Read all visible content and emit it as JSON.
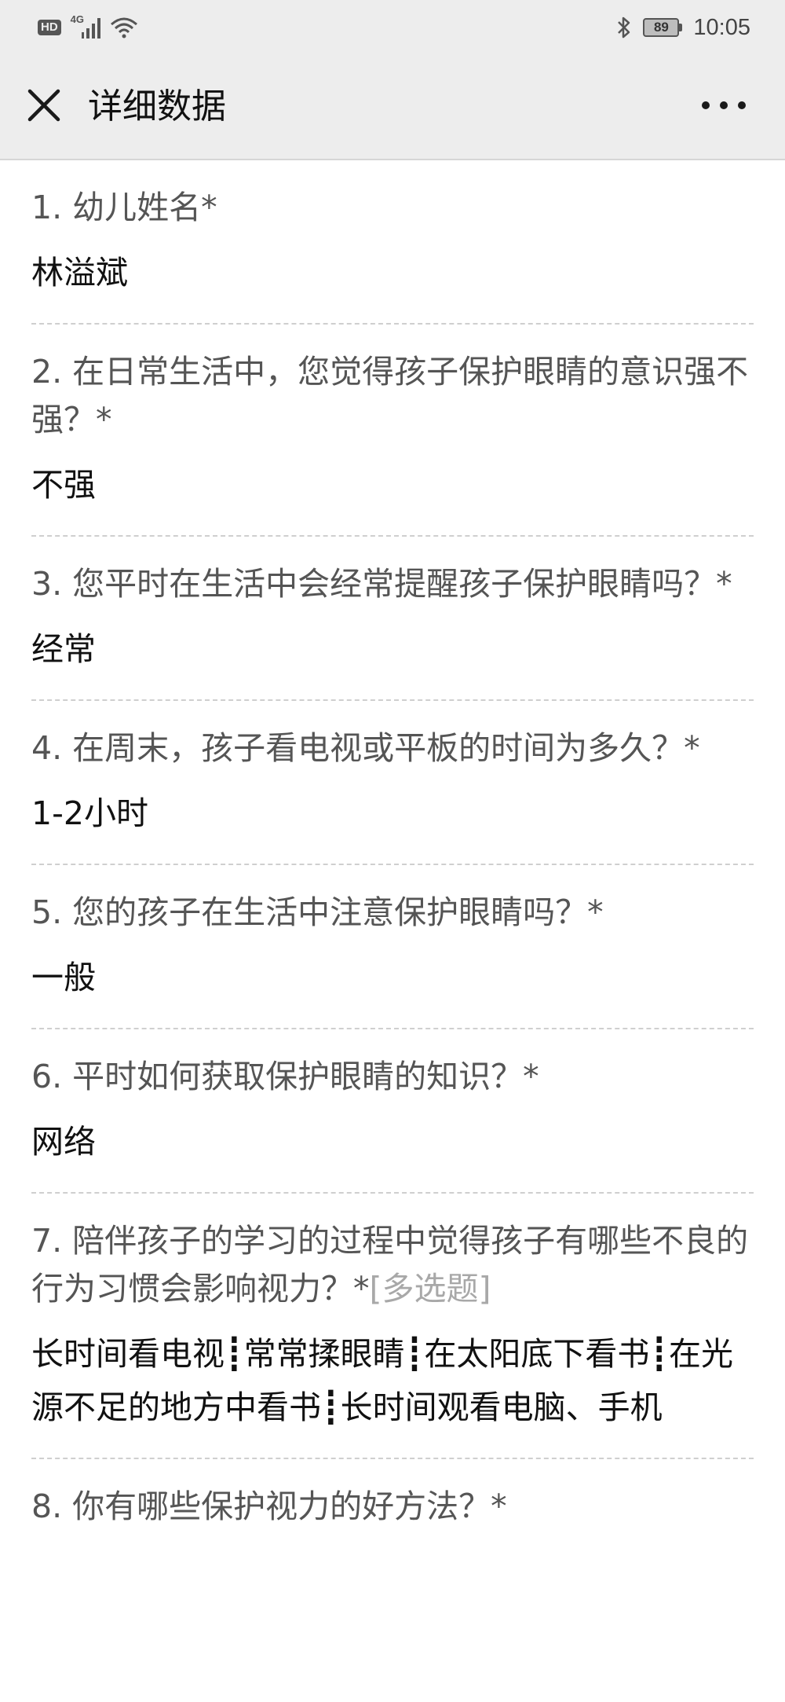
{
  "status_bar": {
    "hd_badge": "HD",
    "network": "4G",
    "time": "10:05",
    "battery_level": "89",
    "icons": [
      "hd-icon",
      "signal-icon",
      "wifi-icon",
      "bluetooth-icon",
      "battery-icon"
    ]
  },
  "header": {
    "title": "详细数据",
    "close_icon": "close-icon",
    "more_icon": "more-dots-icon"
  },
  "questions": [
    {
      "question": "1. 幼儿姓名*",
      "answer": "林溢斌"
    },
    {
      "question": "2. 在日常生活中，您觉得孩子保护眼睛的意识强不强？*",
      "answer": "不强"
    },
    {
      "question": "3. 您平时在生活中会经常提醒孩子保护眼睛吗？*",
      "answer": "经常"
    },
    {
      "question": "4. 在周末，孩子看电视或平板的时间为多久？*",
      "answer": "1-2小时"
    },
    {
      "question": "5. 您的孩子在生活中注意保护眼睛吗？*",
      "answer": "一般"
    },
    {
      "question": "6. 平时如何获取保护眼睛的知识？*",
      "answer": "网络"
    },
    {
      "question": "7. 陪伴孩子的学习的过程中觉得孩子有哪些不良的行为习惯会影响视力？*",
      "tag": "[多选题]",
      "answer": "长时间看电视┋常常揉眼睛┋在太阳底下看书┋在光源不足的地方中看书┋长时间观看电脑、手机"
    },
    {
      "question": "8. 你有哪些保护视力的好方法？*",
      "answer": ""
    }
  ]
}
